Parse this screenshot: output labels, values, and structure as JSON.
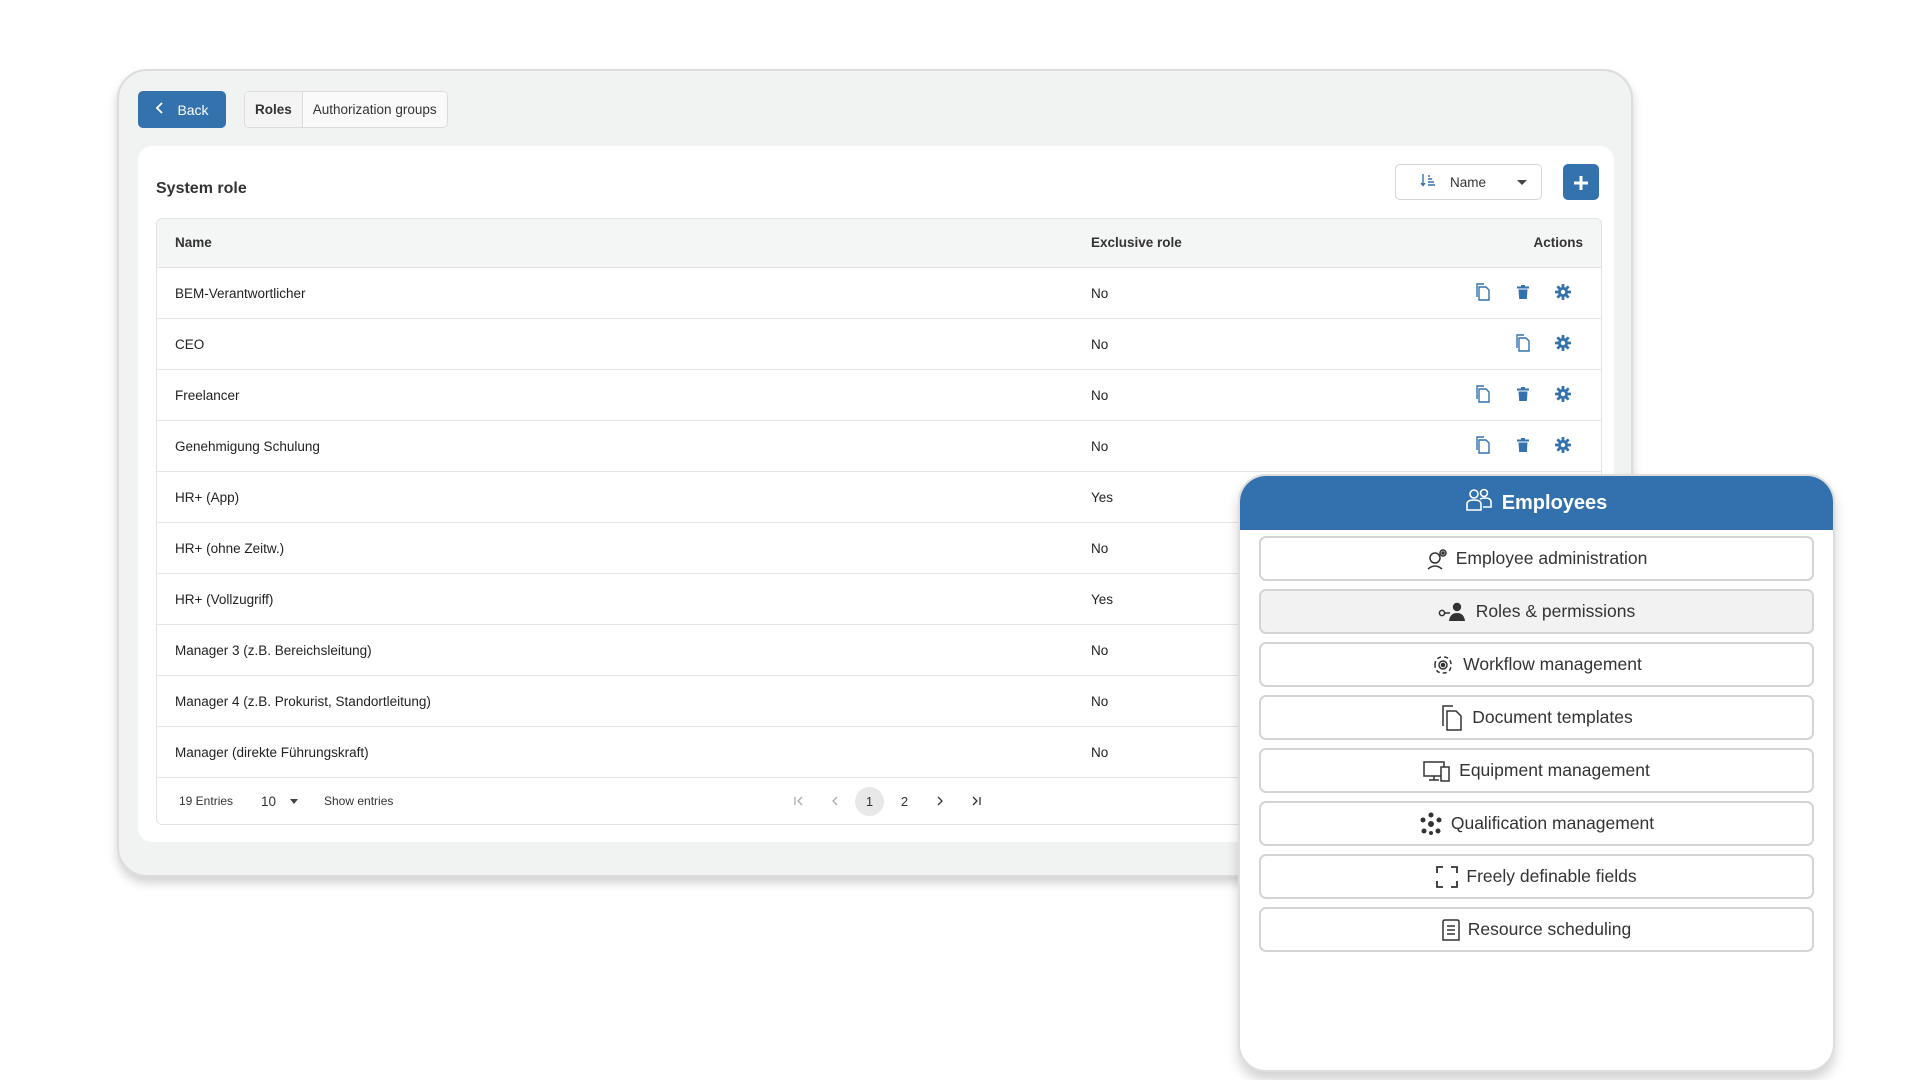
{
  "topbar": {
    "back_label": "Back",
    "tabs": [
      {
        "label": "Roles",
        "active": true
      },
      {
        "label": "Authorization groups",
        "active": false
      }
    ]
  },
  "card": {
    "title": "System role",
    "sort": {
      "icon": "sort-ascending-icon",
      "selected": "Name"
    },
    "add_icon": "plus-icon"
  },
  "table": {
    "columns": {
      "name": "Name",
      "exclusive": "Exclusive role",
      "actions": "Actions"
    },
    "rows": [
      {
        "name": "BEM-Verantwortlicher",
        "exclusive": "No"
      },
      {
        "name": "CEO",
        "exclusive": "No"
      },
      {
        "name": "Freelancer",
        "exclusive": "No"
      },
      {
        "name": "Genehmigung Schulung",
        "exclusive": "No"
      },
      {
        "name": "HR+ (App)",
        "exclusive": "Yes"
      },
      {
        "name": "HR+ (ohne Zeitw.)",
        "exclusive": "No"
      },
      {
        "name": "HR+ (Vollzugriff)",
        "exclusive": "Yes"
      },
      {
        "name": "Manager 3 (z.B. Bereichsleitung)",
        "exclusive": "No"
      },
      {
        "name": "Manager 4 (z.B. Prokurist, Standortleitung)",
        "exclusive": "No"
      },
      {
        "name": "Manager (direkte Führungskraft)",
        "exclusive": "No"
      }
    ]
  },
  "pager": {
    "entries": "19 Entries",
    "per_page": "10",
    "show_entries": "Show entries",
    "pages": [
      "1",
      "2"
    ],
    "current": "1"
  },
  "panel": {
    "title": "Employees",
    "items": [
      {
        "label": "Employee administration",
        "icon": "employee-settings-icon"
      },
      {
        "label": "Roles & permissions",
        "icon": "roles-key-icon",
        "active": true
      },
      {
        "label": "Workflow management",
        "icon": "workflow-gear-icon"
      },
      {
        "label": "Document templates",
        "icon": "documents-icon"
      },
      {
        "label": "Equipment management",
        "icon": "devices-icon"
      },
      {
        "label": "Qualification management",
        "icon": "qualification-icon"
      },
      {
        "label": "Freely definable fields",
        "icon": "expand-fields-icon"
      },
      {
        "label": "Resource scheduling",
        "icon": "clipboard-list-icon"
      }
    ]
  },
  "colors": {
    "accent": "#3372ad",
    "panel_header": "#3271ad"
  }
}
